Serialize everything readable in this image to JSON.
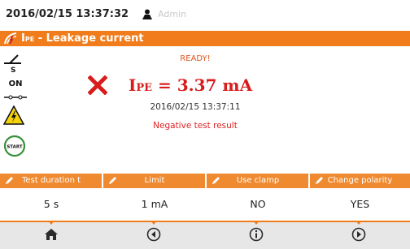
{
  "status": {
    "datetime": "2016/02/15 13:37:32",
    "user_icon": "user-icon",
    "user": "Admin"
  },
  "title": {
    "icon": "leakage-current-icon",
    "symbol": "I",
    "symbol_sub": "PE",
    "text": " - Leakage current"
  },
  "left_icons": [
    "switch-s-icon",
    "on-switch-icon",
    "high-voltage-warning-icon",
    "start-icon"
  ],
  "left_labels": {
    "s": "S",
    "on": "ON",
    "start": "START"
  },
  "measurement": {
    "state": "READY!",
    "result_icon": "fail-x-icon",
    "symbol": "I",
    "symbol_sub": "PE",
    "equals": " = ",
    "value": "3.37",
    "unit": " mA",
    "timestamp": "2016/02/15 13:37:11",
    "result": "Negative test result"
  },
  "params": [
    {
      "label": "Test duration t",
      "value": "5 s"
    },
    {
      "label": "Limit",
      "value": "1 mA"
    },
    {
      "label": "Use clamp",
      "value": "NO"
    },
    {
      "label": "Change polarity",
      "value": "YES"
    }
  ],
  "nav": [
    "home-icon",
    "back-icon",
    "info-icon",
    "forward-icon"
  ],
  "colors": {
    "accent": "#f07c1b",
    "error": "#d81c1c",
    "state": "#e1541c"
  }
}
